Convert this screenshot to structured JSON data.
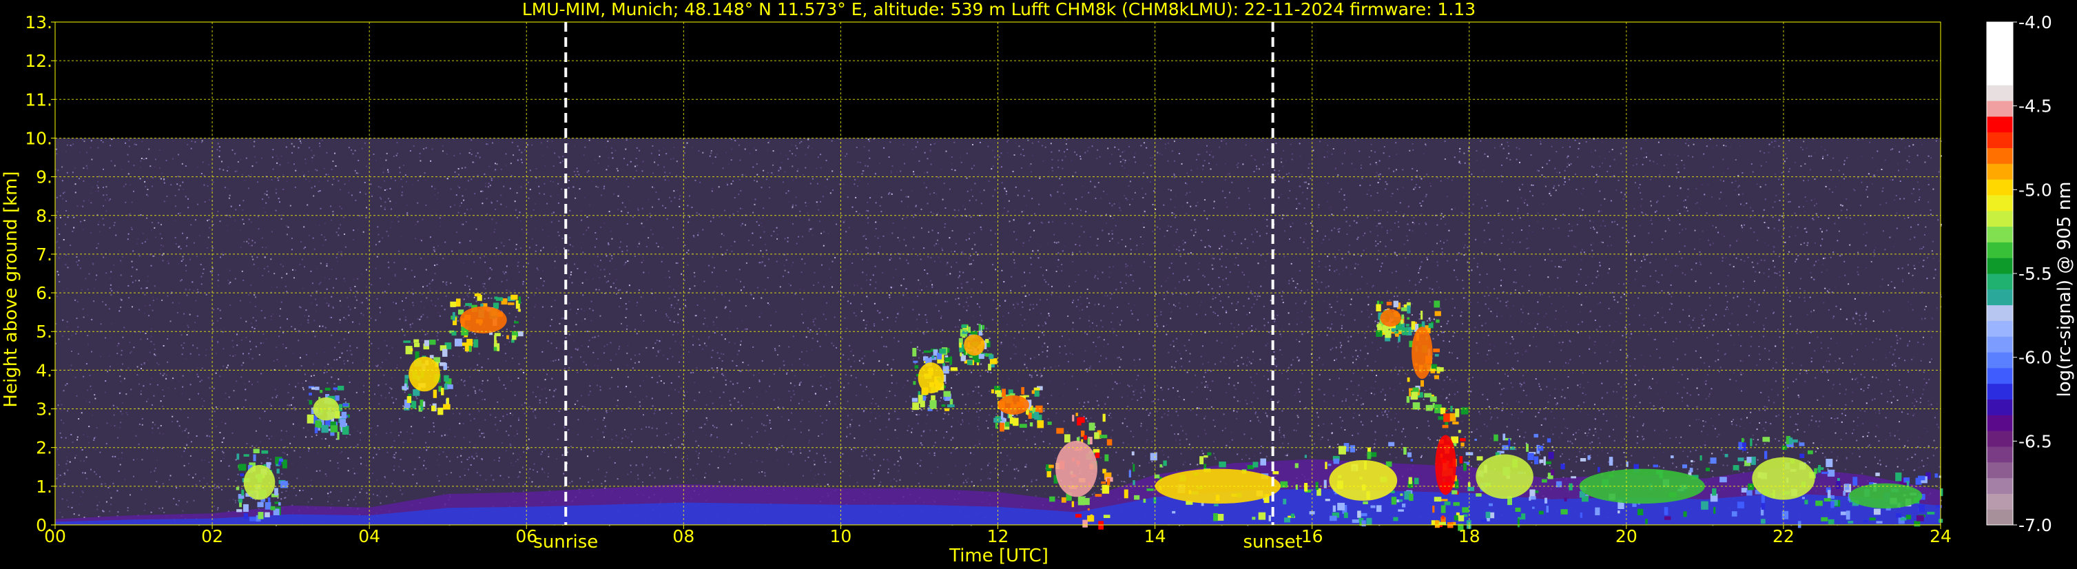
{
  "chart_data": {
    "type": "heatmap",
    "title": "LMU-MIM, Munich; 48.148° N 11.573° E, altitude: 539 m    Lufft CHM8k (CHM8kLMU): 22-11-2024    firmware: 1.13",
    "xlabel": "Time [UTC]",
    "ylabel": "Height above ground [km]",
    "x_ticks": [
      {
        "v": 0,
        "label": "00"
      },
      {
        "v": 2,
        "label": "02"
      },
      {
        "v": 4,
        "label": "04"
      },
      {
        "v": 6,
        "label": "06"
      },
      {
        "v": 8,
        "label": "08"
      },
      {
        "v": 10,
        "label": "10"
      },
      {
        "v": 12,
        "label": "12"
      },
      {
        "v": 14,
        "label": "14"
      },
      {
        "v": 16,
        "label": "16"
      },
      {
        "v": 18,
        "label": "18"
      },
      {
        "v": 20,
        "label": "20"
      },
      {
        "v": 22,
        "label": "22"
      },
      {
        "v": 24,
        "label": "24"
      }
    ],
    "y_ticks": [
      {
        "v": 0,
        "label": "0."
      },
      {
        "v": 1,
        "label": "1."
      },
      {
        "v": 2,
        "label": "2."
      },
      {
        "v": 3,
        "label": "3."
      },
      {
        "v": 4,
        "label": "4."
      },
      {
        "v": 5,
        "label": "5."
      },
      {
        "v": 6,
        "label": "6."
      },
      {
        "v": 7,
        "label": "7."
      },
      {
        "v": 8,
        "label": "8."
      },
      {
        "v": 9,
        "label": "9."
      },
      {
        "v": 10,
        "label": "10."
      },
      {
        "v": 11,
        "label": "11."
      },
      {
        "v": 12,
        "label": "12."
      },
      {
        "v": 13,
        "label": "13."
      }
    ],
    "xlim": [
      0,
      24
    ],
    "ylim": [
      0,
      13
    ],
    "grid": true,
    "grid_color": "#ffff00",
    "text_color": "#ffff00",
    "background": "#000000",
    "noise_top_km": 10,
    "markers": [
      {
        "time": 6.5,
        "label": "sunrise"
      },
      {
        "time": 15.5,
        "label": "sunset"
      }
    ],
    "colorbar": {
      "label": "log(rc-signal) @ 905 nm",
      "range": [
        -7.0,
        -4.0
      ],
      "tick_labels": [
        {
          "v": -4.0,
          "label": "-4.0"
        },
        {
          "v": -4.5,
          "label": "-4.5"
        },
        {
          "v": -5.0,
          "label": "-5.0"
        },
        {
          "v": -5.5,
          "label": "-5.5"
        },
        {
          "v": -6.0,
          "label": "-6.0"
        },
        {
          "v": -6.5,
          "label": "-6.5"
        },
        {
          "v": -7.0,
          "label": "-7.0"
        }
      ],
      "colors": [
        "#a8909a",
        "#b89cae",
        "#a47fa6",
        "#8d5c91",
        "#7a3c84",
        "#6a1f7a",
        "#5a0a8a",
        "#3a10b0",
        "#2a2ee0",
        "#3f5cff",
        "#5a80ff",
        "#7d9cff",
        "#9ab4ff",
        "#b6c6f0",
        "#2aa89a",
        "#20b070",
        "#0d9a2a",
        "#38c038",
        "#80e050",
        "#c8f040",
        "#f0f020",
        "#ffd800",
        "#ffa800",
        "#ff7000",
        "#ff3000",
        "#ff0000",
        "#f0a0a0",
        "#e8e0e0",
        "#ffffff",
        "#ffffff",
        "#ffffff",
        "#ffffff"
      ]
    },
    "layers": [
      {
        "name": "boundary-layer-aerosol",
        "t": [
          0,
          1,
          2,
          3,
          4,
          5,
          6,
          7,
          8,
          9,
          10,
          11,
          12,
          13,
          14,
          15,
          16,
          17,
          18,
          19,
          20,
          21,
          22,
          23,
          24
        ],
        "top_km": [
          0.15,
          0.25,
          0.3,
          0.5,
          0.45,
          0.8,
          0.85,
          0.95,
          1.05,
          1.0,
          0.95,
          0.95,
          0.85,
          0.6,
          1.3,
          1.6,
          1.7,
          1.6,
          1.5,
          1.2,
          1.3,
          1.2,
          1.5,
          1.3,
          0.9
        ]
      }
    ],
    "cloud_features": [
      {
        "t0": 3.2,
        "t1": 3.7,
        "base_km": 2.4,
        "top_km": 3.6,
        "value": -5.2
      },
      {
        "t0": 4.4,
        "t1": 5.0,
        "base_km": 3.0,
        "top_km": 4.8,
        "value": -5.0
      },
      {
        "t0": 5.0,
        "t1": 5.9,
        "base_km": 4.6,
        "top_km": 6.0,
        "value": -4.8
      },
      {
        "t0": 10.9,
        "t1": 11.4,
        "base_km": 3.0,
        "top_km": 4.6,
        "value": -5.0
      },
      {
        "t0": 11.5,
        "t1": 11.9,
        "base_km": 4.1,
        "top_km": 5.2,
        "value": -4.9
      },
      {
        "t0": 11.9,
        "t1": 12.5,
        "base_km": 2.6,
        "top_km": 3.6,
        "value": -4.8
      },
      {
        "t0": 12.6,
        "t1": 13.4,
        "base_km": 0.0,
        "top_km": 2.9,
        "value": -4.5
      },
      {
        "t0": 16.8,
        "t1": 17.2,
        "base_km": 4.9,
        "top_km": 5.8,
        "value": -4.8
      },
      {
        "t0": 17.2,
        "t1": 17.6,
        "base_km": 3.1,
        "top_km": 5.8,
        "value": -4.8
      },
      {
        "t0": 17.5,
        "t1": 17.9,
        "base_km": 0.0,
        "top_km": 3.1,
        "value": -4.6
      }
    ],
    "low_clouds": [
      {
        "t0": 2.3,
        "t1": 2.9,
        "base_km": 0.2,
        "top_km": 2.0,
        "value": -5.2
      },
      {
        "t0": 13.6,
        "t1": 16.0,
        "base_km": 0.1,
        "top_km": 1.9,
        "value": -5.0
      },
      {
        "t0": 16.0,
        "t1": 17.3,
        "base_km": 0.1,
        "top_km": 2.2,
        "value": -5.1
      },
      {
        "t0": 17.9,
        "t1": 19.0,
        "base_km": 0.1,
        "top_km": 2.4,
        "value": -5.2
      },
      {
        "t0": 19.0,
        "t1": 21.4,
        "base_km": 0.1,
        "top_km": 1.9,
        "value": -5.4
      },
      {
        "t0": 21.4,
        "t1": 22.6,
        "base_km": 0.1,
        "top_km": 2.3,
        "value": -5.2
      },
      {
        "t0": 22.6,
        "t1": 24.0,
        "base_km": 0.1,
        "top_km": 1.4,
        "value": -5.4
      }
    ]
  }
}
